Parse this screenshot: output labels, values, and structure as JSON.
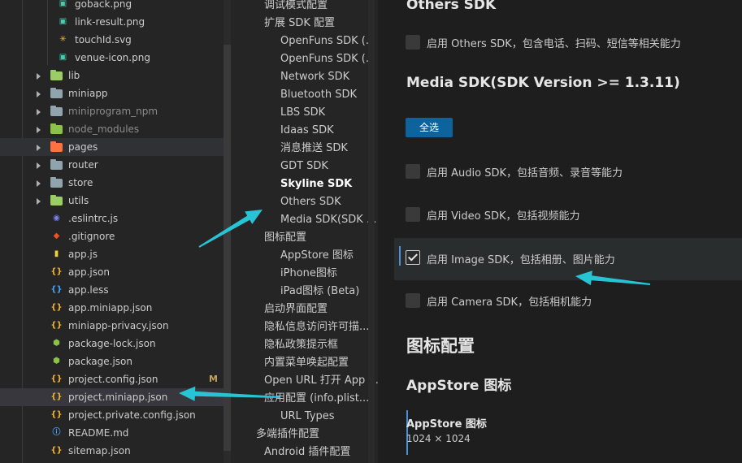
{
  "explorer": {
    "rows": [
      {
        "label": "goback.png",
        "icon": "image-file-icon",
        "color": "#4ec9b0"
      },
      {
        "label": "link-result.png",
        "icon": "image-file-icon",
        "color": "#4ec9b0"
      },
      {
        "label": "touchId.svg",
        "icon": "svg-file-icon",
        "color": "#f0b42d"
      },
      {
        "label": "venue-icon.png",
        "icon": "image-file-icon",
        "color": "#4ec9b0"
      },
      {
        "label": "lib",
        "icon": "folder-icon",
        "color": "#9ccc65"
      },
      {
        "label": "miniapp",
        "icon": "folder-icon",
        "color": "#90a4ae"
      },
      {
        "label": "miniprogram_npm",
        "icon": "folder-icon",
        "color": "#90a4ae"
      },
      {
        "label": "node_modules",
        "icon": "folder-icon",
        "color": "#8bc34a"
      },
      {
        "label": "pages",
        "icon": "folder-icon",
        "color": "#ff7043"
      },
      {
        "label": "router",
        "icon": "folder-icon",
        "color": "#90a4ae"
      },
      {
        "label": "store",
        "icon": "folder-icon",
        "color": "#90a4ae"
      },
      {
        "label": "utils",
        "icon": "folder-icon",
        "color": "#9ccc65"
      },
      {
        "label": ".eslintrc.js",
        "icon": "eslint-file-icon",
        "color": "#7c7ff0"
      },
      {
        "label": ".gitignore",
        "icon": "git-file-icon",
        "color": "#f4511e"
      },
      {
        "label": "app.js",
        "icon": "js-file-icon",
        "color": "#f0d03a"
      },
      {
        "label": "app.json",
        "icon": "json-file-icon",
        "color": "#f0b42d"
      },
      {
        "label": "app.less",
        "icon": "less-file-icon",
        "color": "#42a5f5"
      },
      {
        "label": "app.miniapp.json",
        "icon": "json-file-icon",
        "color": "#f0b42d"
      },
      {
        "label": "miniapp-privacy.json",
        "icon": "json-file-icon",
        "color": "#f0b42d"
      },
      {
        "label": "package-lock.json",
        "icon": "node-file-icon",
        "color": "#8bc34a"
      },
      {
        "label": "package.json",
        "icon": "node-file-icon",
        "color": "#8bc34a"
      },
      {
        "label": "project.config.json",
        "icon": "json-file-icon",
        "color": "#f0b42d",
        "badge": "M"
      },
      {
        "label": "project.miniapp.json",
        "icon": "json-file-icon",
        "color": "#f0b42d",
        "selected": true
      },
      {
        "label": "project.private.config.json",
        "icon": "json-file-icon",
        "color": "#f0b42d"
      },
      {
        "label": "README.md",
        "icon": "info-file-icon",
        "color": "#42a5f5"
      },
      {
        "label": "sitemap.json",
        "icon": "json-file-icon",
        "color": "#f0b42d"
      }
    ]
  },
  "nav": {
    "items": [
      {
        "label": "调试模式配置",
        "level": 1
      },
      {
        "label": "扩展 SDK 配置",
        "level": 1
      },
      {
        "label": "OpenFuns SDK (...",
        "level": 2
      },
      {
        "label": "OpenFuns SDK (...",
        "level": 2
      },
      {
        "label": "Network SDK",
        "level": 2
      },
      {
        "label": "Bluetooth SDK",
        "level": 2
      },
      {
        "label": "LBS SDK",
        "level": 2
      },
      {
        "label": "Idaas SDK",
        "level": 2
      },
      {
        "label": "消息推送 SDK",
        "level": 2
      },
      {
        "label": "GDT SDK",
        "level": 2
      },
      {
        "label": "Skyline SDK",
        "level": 2,
        "bold": true
      },
      {
        "label": "Others SDK",
        "level": 2
      },
      {
        "label": "Media SDK(SDK ...",
        "level": 2
      },
      {
        "label": "图标配置",
        "level": 1
      },
      {
        "label": "AppStore 图标",
        "level": 2
      },
      {
        "label": "iPhone图标",
        "level": 2
      },
      {
        "label": "iPad图标 (Beta)",
        "level": 2
      },
      {
        "label": "启动界面配置",
        "level": 1
      },
      {
        "label": "隐私信息访问许可描...",
        "level": 1
      },
      {
        "label": "隐私政策提示框",
        "level": 1
      },
      {
        "label": "内置菜单唤起配置",
        "level": 1
      },
      {
        "label": "Open URL 打开 App ...",
        "level": 1
      },
      {
        "label": "应用配置 (info.plist...",
        "level": 1
      },
      {
        "label": "URL Types",
        "level": 2
      },
      {
        "label": "多端插件配置",
        "level": 0
      },
      {
        "label": "Android 插件配置",
        "level": 1
      }
    ]
  },
  "content": {
    "others_heading": "Others SDK",
    "others_checkbox": "启用 Others SDK，包含电话、扫码、短信等相关能力",
    "media_heading": "Media SDK(SDK Version >= 1.3.11)",
    "select_all": "全选",
    "media_options": [
      {
        "label": "启用 Audio SDK，包括音频、录音等能力",
        "checked": false
      },
      {
        "label": "启用 Video SDK，包括视频能力",
        "checked": false
      },
      {
        "label": "启用 Image SDK，包括相册、图片能力",
        "checked": true
      },
      {
        "label": "启用 Camera SDK，包括相机能力",
        "checked": false
      }
    ],
    "icon_section_heading": "图标配置",
    "appstore_heading": "AppStore 图标",
    "appstore_card_title": "AppStore 图标",
    "appstore_card_size": "1024 × 1024"
  },
  "colors": {
    "arrow": "#27c4d6",
    "button": "#0e639c",
    "focus": "#4a90d9"
  }
}
